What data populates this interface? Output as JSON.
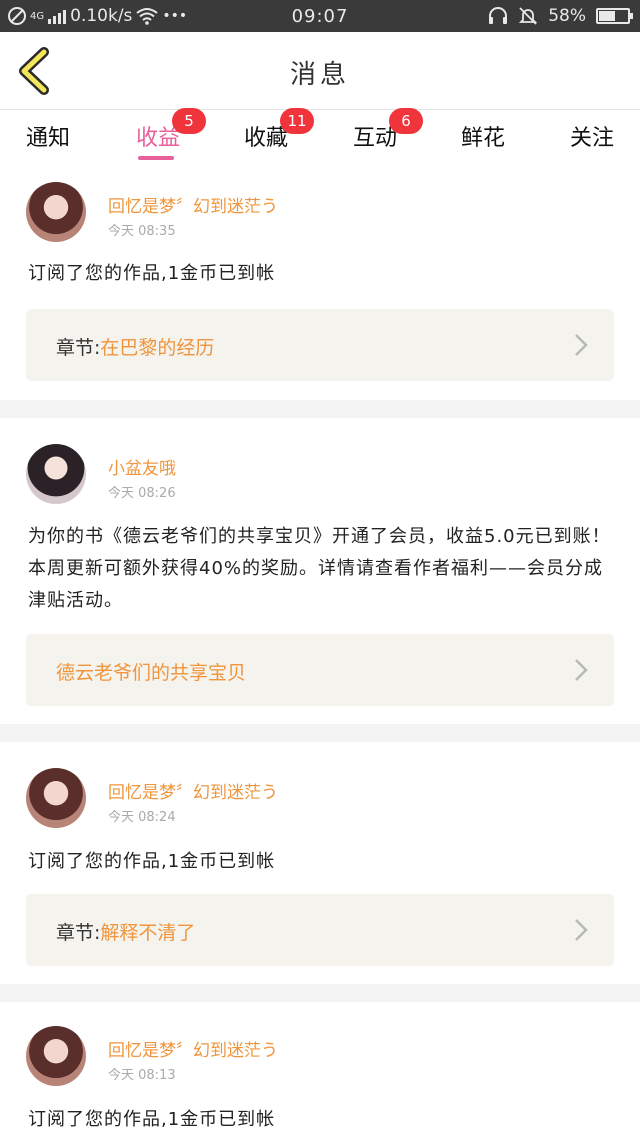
{
  "status_bar": {
    "network": "4G",
    "speed": "0.10k/s",
    "dots": "•••",
    "time": "09:07",
    "battery": "58%",
    "battery_level": 0.58
  },
  "header": {
    "title": "消息"
  },
  "tabs": [
    {
      "label": "通知",
      "badge": ""
    },
    {
      "label": "收益",
      "badge": "5"
    },
    {
      "label": "收藏",
      "badge": "11"
    },
    {
      "label": "互动",
      "badge": "6"
    },
    {
      "label": "鲜花",
      "badge": ""
    },
    {
      "label": "关注",
      "badge": ""
    }
  ],
  "messages": [
    {
      "user": "回忆是梦〞幻到迷茫う",
      "time": "今天 08:35",
      "text": "订阅了您的作品,1金币已到帐",
      "link_label": "章节:",
      "link_value": "在巴黎的经历"
    },
    {
      "user": "小盆友哦",
      "time": "今天 08:26",
      "text": "为你的书《德云老爷们的共享宝贝》开通了会员，收益5.0元已到账！本周更新可额外获得40%的奖励。详情请查看作者福利——会员分成津贴活动。",
      "link_label": "",
      "link_value": "德云老爷们的共享宝贝"
    },
    {
      "user": "回忆是梦〞幻到迷茫う",
      "time": "今天 08:24",
      "text": "订阅了您的作品,1金币已到帐",
      "link_label": "章节:",
      "link_value": "解释不清了"
    },
    {
      "user": "回忆是梦〞幻到迷茫う",
      "time": "今天 08:13",
      "text": "订阅了您的作品,1金币已到帐"
    }
  ]
}
